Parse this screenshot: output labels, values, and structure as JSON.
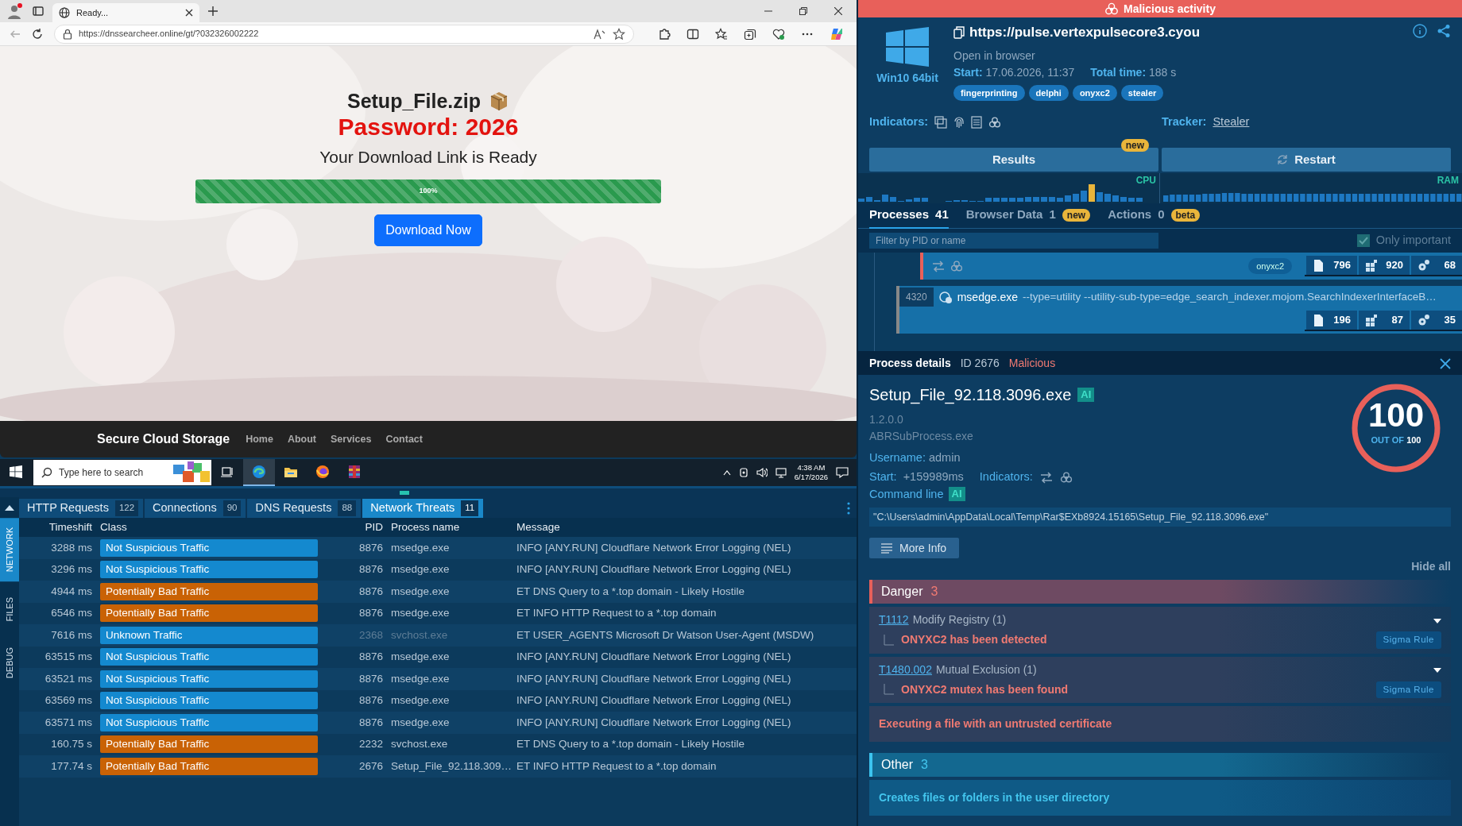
{
  "browser": {
    "tab_title": "Ready...",
    "url": "https://dnssearcheer.online/gt/?032326002222"
  },
  "page": {
    "title": "Setup_File.zip",
    "password": "Password: 2026",
    "subtitle": "Your Download Link is Ready",
    "progress": {
      "level": 1,
      "label": "100%"
    },
    "button": "Download Now",
    "footer": {
      "brand": "Secure Cloud Storage",
      "links": [
        "Home",
        "About",
        "Services",
        "Contact"
      ]
    }
  },
  "taskbar": {
    "search_placeholder": "Type here to search",
    "apps": [
      {
        "kind": "taskview",
        "selected": false
      },
      {
        "kind": "edge",
        "selected": true
      },
      {
        "kind": "explorer",
        "selected": false
      },
      {
        "kind": "firefox",
        "selected": false
      },
      {
        "kind": "winrar",
        "selected": false
      }
    ],
    "time": "4:38 AM",
    "date": "6/17/2026"
  },
  "bottom_panel": {
    "side_tabs": [
      {
        "label": "NETWORK",
        "selected": true
      },
      {
        "label": "FILES",
        "selected": false
      },
      {
        "label": "DEBUG",
        "selected": false
      }
    ],
    "tabs": [
      {
        "label": "HTTP Requests",
        "count": "122",
        "selected": false
      },
      {
        "label": "Connections",
        "count": "90",
        "selected": false
      },
      {
        "label": "DNS Requests",
        "count": "88",
        "selected": false
      },
      {
        "label": "Network Threats",
        "count": "11",
        "selected": true
      }
    ],
    "table": {
      "columns": [
        "Timeshift",
        "Class",
        "PID",
        "Process name",
        "Message"
      ],
      "rows": [
        {
          "timeshift": "3288 ms",
          "class": "Not Suspicious Traffic",
          "kind": "not_suspicious",
          "pid": "8876",
          "process": "msedge.exe",
          "message": "INFO [ANY.RUN] Cloudflare Network Error Logging (NEL)",
          "dimmed": false
        },
        {
          "timeshift": "3296 ms",
          "class": "Not Suspicious Traffic",
          "kind": "not_suspicious",
          "pid": "8876",
          "process": "msedge.exe",
          "message": "INFO [ANY.RUN] Cloudflare Network Error Logging (NEL)",
          "dimmed": false
        },
        {
          "timeshift": "4944 ms",
          "class": "Potentially Bad Traffic",
          "kind": "potentially_bad",
          "pid": "8876",
          "process": "msedge.exe",
          "message": "ET DNS Query to a *.top domain - Likely Hostile",
          "dimmed": false
        },
        {
          "timeshift": "6546 ms",
          "class": "Potentially Bad Traffic",
          "kind": "potentially_bad",
          "pid": "8876",
          "process": "msedge.exe",
          "message": "ET INFO HTTP Request to a *.top domain",
          "dimmed": false
        },
        {
          "timeshift": "7616 ms",
          "class": "Unknown Traffic",
          "kind": "unknown",
          "pid": "2368",
          "process": "svchost.exe",
          "message": "ET USER_AGENTS Microsoft Dr Watson User-Agent (MSDW)",
          "dimmed": true
        },
        {
          "timeshift": "63515 ms",
          "class": "Not Suspicious Traffic",
          "kind": "not_suspicious",
          "pid": "8876",
          "process": "msedge.exe",
          "message": "INFO [ANY.RUN] Cloudflare Network Error Logging (NEL)",
          "dimmed": false
        },
        {
          "timeshift": "63521 ms",
          "class": "Not Suspicious Traffic",
          "kind": "not_suspicious",
          "pid": "8876",
          "process": "msedge.exe",
          "message": "INFO [ANY.RUN] Cloudflare Network Error Logging (NEL)",
          "dimmed": false
        },
        {
          "timeshift": "63569 ms",
          "class": "Not Suspicious Traffic",
          "kind": "not_suspicious",
          "pid": "8876",
          "process": "msedge.exe",
          "message": "INFO [ANY.RUN] Cloudflare Network Error Logging (NEL)",
          "dimmed": false
        },
        {
          "timeshift": "63571 ms",
          "class": "Not Suspicious Traffic",
          "kind": "not_suspicious",
          "pid": "8876",
          "process": "msedge.exe",
          "message": "INFO [ANY.RUN] Cloudflare Network Error Logging (NEL)",
          "dimmed": false
        },
        {
          "timeshift": "160.75 s",
          "class": "Potentially Bad Traffic",
          "kind": "potentially_bad",
          "pid": "2232",
          "process": "svchost.exe",
          "message": "ET DNS Query to a *.top domain - Likely Hostile",
          "dimmed": false
        },
        {
          "timeshift": "177.74 s",
          "class": "Potentially Bad Traffic",
          "kind": "potentially_bad",
          "pid": "2676",
          "process": "Setup_File_92.118.309…",
          "message": "ET INFO HTTP Request to a *.top domain",
          "dimmed": false
        }
      ]
    }
  },
  "sandbox": {
    "verdict": "Malicious activity",
    "os": "Win10 64bit",
    "url": "https://pulse.vertexpulsecore3.cyou",
    "action": "Open in browser",
    "start_label": "Start:",
    "start": "17.06.2026, 11:37",
    "total_label": "Total time:",
    "total": "188 s",
    "tags": [
      "fingerprinting",
      "delphi",
      "onyxc2",
      "stealer"
    ],
    "indicators_label": "Indicators:",
    "tracker_label": "Tracker:",
    "tracker": "Stealer",
    "results": {
      "label": "Results",
      "badge": "new"
    },
    "restart": "Restart",
    "cpu_label": "CPU",
    "ram_label": "RAM",
    "tabs": [
      {
        "label": "Processes",
        "count": "41",
        "selected": true
      },
      {
        "label": "Browser Data",
        "count": "1",
        "badge": "new",
        "selected": false
      },
      {
        "label": "Actions",
        "count": "0",
        "badge": "beta",
        "selected": false
      }
    ],
    "filter_placeholder": "Filter by PID or name",
    "only_important": {
      "label": "Only important",
      "checked": true
    },
    "processes": [
      {
        "kind": "partial",
        "malicious": true,
        "tag": "onyxc2",
        "files": "796",
        "registry": "920",
        "modules": "68"
      },
      {
        "kind": "full",
        "malicious": false,
        "pid": "4320",
        "name": "msedge.exe",
        "args": "--type=utility --utility-sub-type=edge_search_indexer.mojom.SearchIndexerInterfaceB…",
        "files": "196",
        "registry": "87",
        "modules": "35"
      }
    ],
    "details": {
      "header": "Process details",
      "id": "ID 2676",
      "verdict": "Malicious",
      "name": "Setup_File_92.118.3096.exe",
      "ai_badge": "AI",
      "version": "1.2.0.0",
      "original_name": "ABRSubProcess.exe",
      "username_label": "Username:",
      "username": "admin",
      "start_label": "Start:",
      "start": "+159989ms",
      "indicators_label": "Indicators:",
      "cmdline_label": "Command line",
      "cmdline_badge": "AI",
      "cmdline": "\"C:\\Users\\admin\\AppData\\Local\\Temp\\Rar$EXb8924.15165\\Setup_File_92.118.3096.exe\"",
      "more_info": "More Info",
      "hide_all": "Hide all",
      "score": "100",
      "score_caption": "OUT OF",
      "score_max": "100",
      "sections": [
        {
          "kind": "danger",
          "title": "Danger",
          "count": "3",
          "items": [
            {
              "kind": "technique",
              "technique": "T1112",
              "title": "Modify Registry (1)",
              "detail": "ONYXC2 has been detected",
              "rule": "Sigma Rule"
            },
            {
              "kind": "technique",
              "technique": "T1480.002",
              "title": "Mutual Exclusion (1)",
              "detail": "ONYXC2 mutex has been found",
              "rule": "Sigma Rule"
            },
            {
              "kind": "plain",
              "title": "Executing a file with an untrusted certificate"
            }
          ]
        },
        {
          "kind": "other",
          "title": "Other",
          "count": "3",
          "items": [
            {
              "kind": "plain",
              "title": "Creates files or folders in the user directory"
            }
          ]
        }
      ]
    }
  }
}
